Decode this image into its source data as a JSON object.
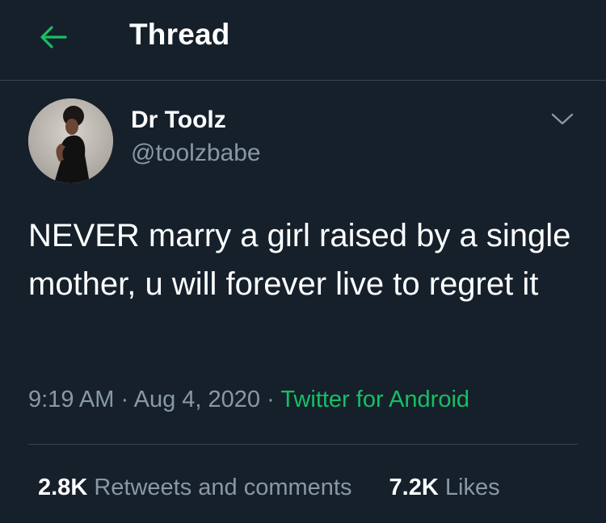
{
  "header": {
    "title": "Thread",
    "back_icon": "arrow-left-icon",
    "accent_color": "#17bf63"
  },
  "tweet": {
    "author_name": "Dr Toolz",
    "author_handle": "@toolzbabe",
    "menu_icon": "chevron-down-icon",
    "text": "NEVER marry a girl raised by a single mother, u will forever live to regret it",
    "time": "9:19 AM",
    "separator": "·",
    "date": "Aug 4, 2020",
    "source": "Twitter for Android"
  },
  "stats": {
    "retweets_count": "2.8K",
    "retweets_label": "Retweets and comments",
    "likes_count": "7.2K",
    "likes_label": "Likes"
  },
  "colors": {
    "background": "#15202b",
    "secondary_text": "#8899a6",
    "divider": "#38444d",
    "source_link": "#17bf63"
  }
}
